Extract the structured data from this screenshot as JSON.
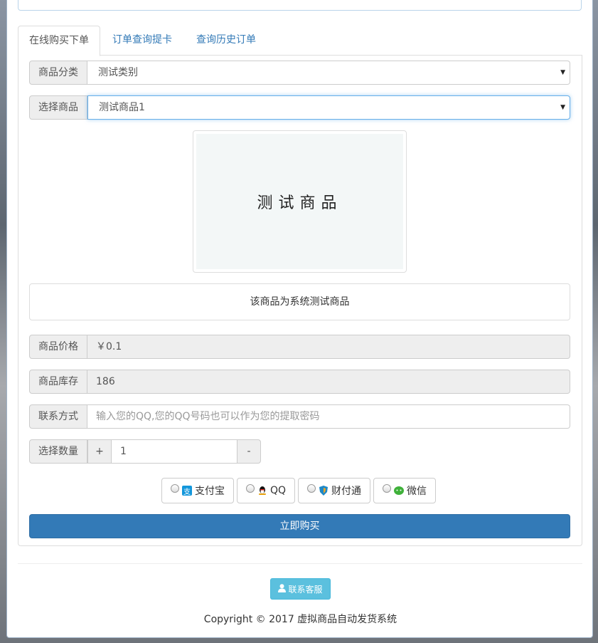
{
  "tabs": [
    {
      "label": "在线购买下单",
      "active": true
    },
    {
      "label": "订单查询提卡",
      "active": false
    },
    {
      "label": "查询历史订单",
      "active": false
    }
  ],
  "form": {
    "category": {
      "label": "商品分类",
      "value": "测试类别"
    },
    "product": {
      "label": "选择商品",
      "value": "测试商品1"
    },
    "image_text": "测试商品",
    "description": "该商品为系统测试商品",
    "price": {
      "label": "商品价格",
      "value": "￥0.1"
    },
    "stock": {
      "label": "商品库存",
      "value": "186"
    },
    "contact": {
      "label": "联系方式",
      "placeholder": "输入您的QQ,您的QQ号码也可以作为您的提取密码"
    },
    "quantity": {
      "label": "选择数量",
      "plus": "+",
      "minus": "-",
      "value": "1"
    }
  },
  "payment_methods": [
    {
      "label": "支付宝",
      "icon": "alipay-icon",
      "color": "#1296db"
    },
    {
      "label": "QQ",
      "icon": "qq-penguin-icon",
      "color": "#000000"
    },
    {
      "label": "财付通",
      "icon": "tenpay-shield-icon",
      "color": "#1e88c7"
    },
    {
      "label": "微信",
      "icon": "wechat-icon",
      "color": "#3fb13a"
    }
  ],
  "buy_button": "立即购买",
  "service_button": "联系客服",
  "copyright": "Copyright © 2017 虚拟商品自动发货系统",
  "colors": {
    "primary": "#337ab7",
    "info": "#5bc0de",
    "link": "#337ab7"
  }
}
